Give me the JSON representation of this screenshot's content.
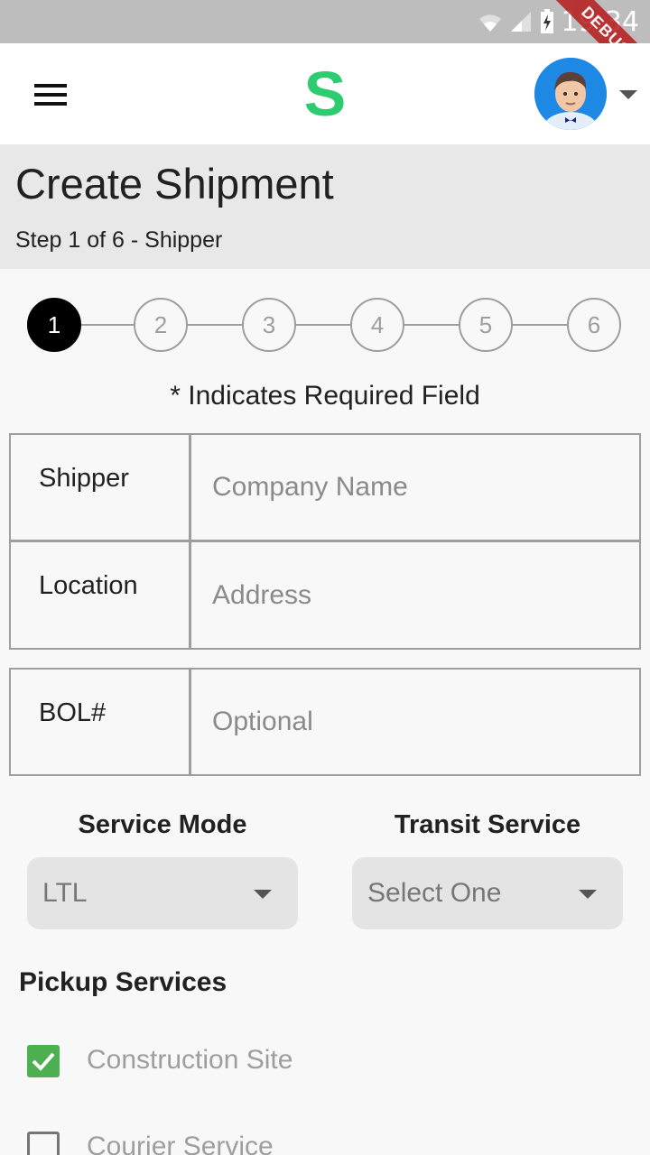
{
  "status_bar": {
    "time": "19:34",
    "debug_label": "DEBUG"
  },
  "app_bar": {
    "logo_letter": "S",
    "logo_color": "#2ecc71"
  },
  "header": {
    "title": "Create Shipment",
    "subtitle": "Step 1 of 6 - Shipper"
  },
  "stepper": {
    "steps": [
      "1",
      "2",
      "3",
      "4",
      "5",
      "6"
    ],
    "active_step": 1
  },
  "required_note": "* Indicates Required Field",
  "form": {
    "shipper": {
      "label": "Shipper",
      "placeholder": "Company Name",
      "value": ""
    },
    "location": {
      "label": "Location",
      "placeholder": "Address",
      "value": ""
    },
    "bol": {
      "label": "BOL#",
      "placeholder": "Optional",
      "value": ""
    }
  },
  "service_mode": {
    "label": "Service Mode",
    "selected": "LTL"
  },
  "transit_service": {
    "label": "Transit Service",
    "selected": "Select One"
  },
  "pickup_services": {
    "title": "Pickup Services",
    "options": [
      {
        "label": "Construction Site",
        "checked": true
      },
      {
        "label": "Courier Service",
        "checked": false
      }
    ]
  },
  "colors": {
    "check_green": "#4caf50",
    "avatar_blue": "#1e88e5"
  }
}
